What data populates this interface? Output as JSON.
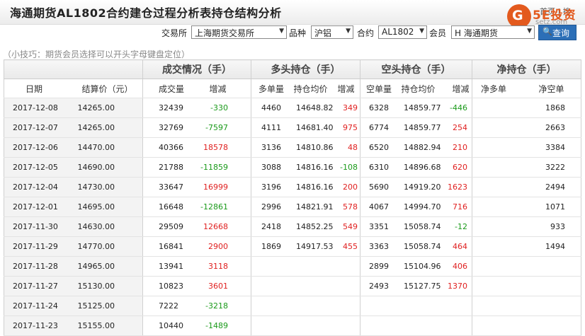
{
  "header": {
    "title": "海通期货AL1802合约建仓过程分析表持仓结构分析",
    "util_text": "首页 | 搜"
  },
  "logo": {
    "glyph": "G",
    "brand": "5E投资",
    "domain": "setz.com",
    "color": "#e35a1e"
  },
  "filters": {
    "exchange_label": "交易所",
    "exchange_value": "上海期货交易所",
    "variety_label": "品种",
    "variety_value": "沪铝",
    "contract_label": "合约",
    "contract_value": "AL1802",
    "member_label": "会员",
    "member_value": "H 海通期货",
    "query_label": "查询",
    "dropdown_icon": "▼"
  },
  "tip": "（小技巧：期货会员选择可以开头字母键盘定位）",
  "table": {
    "group_headers": {
      "trade": "成交情况（手）",
      "long": "多头持仓（手）",
      "short": "空头持仓（手）",
      "net": "净持仓（手）"
    },
    "columns": [
      "日期",
      "结算价（元）",
      "成交量",
      "增减",
      "多单量",
      "持仓均价",
      "增减",
      "空单量",
      "持仓均价",
      "增减",
      "净多单",
      "净空单"
    ],
    "rows": [
      [
        "2017-12-08",
        "14265.00",
        "32439",
        "-330",
        "4460",
        "14648.82",
        "349",
        "6328",
        "14859.77",
        "-446",
        "",
        "1868"
      ],
      [
        "2017-12-07",
        "14265.00",
        "32769",
        "-7597",
        "4111",
        "14681.40",
        "975",
        "6774",
        "14859.77",
        "254",
        "",
        "2663"
      ],
      [
        "2017-12-06",
        "14470.00",
        "40366",
        "18578",
        "3136",
        "14810.86",
        "48",
        "6520",
        "14882.94",
        "210",
        "",
        "3384"
      ],
      [
        "2017-12-05",
        "14690.00",
        "21788",
        "-11859",
        "3088",
        "14816.16",
        "-108",
        "6310",
        "14896.68",
        "620",
        "",
        "3222"
      ],
      [
        "2017-12-04",
        "14730.00",
        "33647",
        "16999",
        "3196",
        "14816.16",
        "200",
        "5690",
        "14919.20",
        "1623",
        "",
        "2494"
      ],
      [
        "2017-12-01",
        "14695.00",
        "16648",
        "-12861",
        "2996",
        "14821.91",
        "578",
        "4067",
        "14994.70",
        "716",
        "",
        "1071"
      ],
      [
        "2017-11-30",
        "14630.00",
        "29509",
        "12668",
        "2418",
        "14852.25",
        "549",
        "3351",
        "15058.74",
        "-12",
        "",
        "933"
      ],
      [
        "2017-11-29",
        "14770.00",
        "16841",
        "2900",
        "1869",
        "14917.53",
        "455",
        "3363",
        "15058.74",
        "464",
        "",
        "1494"
      ],
      [
        "2017-11-28",
        "14965.00",
        "13941",
        "3118",
        "",
        "",
        "",
        "2899",
        "15104.96",
        "406",
        "",
        ""
      ],
      [
        "2017-11-27",
        "15130.00",
        "10823",
        "3601",
        "",
        "",
        "",
        "2493",
        "15127.75",
        "1370",
        "",
        ""
      ],
      [
        "2017-11-24",
        "15125.00",
        "7222",
        "-3218",
        "",
        "",
        "",
        "",
        "",
        "",
        "",
        ""
      ],
      [
        "2017-11-23",
        "15155.00",
        "10440",
        "-1489",
        "",
        "",
        "",
        "",
        "",
        "",
        "",
        ""
      ]
    ]
  },
  "colors": {
    "increase": "#e02020",
    "decrease": "#1a9a1a",
    "button": "#2c6fb7"
  }
}
